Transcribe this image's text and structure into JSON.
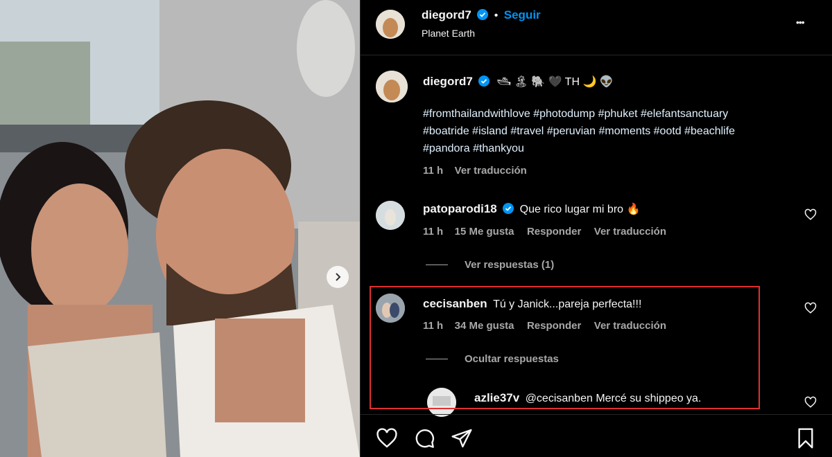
{
  "post": {
    "author": "diegord7",
    "follow_label": "Seguir",
    "location": "Planet Earth",
    "more_label": "•••",
    "caption_emojis": "🛥 🏝 🐘 🖤 TH 🌙 👽",
    "caption": [
      "#fromthailandwithlove #photodump #phuket #elefantsanctuary",
      "#boatride #island #travel #peruvian #moments #ootd #beachlife",
      "#pandora #thankyou"
    ],
    "caption_time": "11 h",
    "caption_translate": "Ver traducción"
  },
  "comments": [
    {
      "user": "patoparodi18",
      "verified": true,
      "text": "Que rico lugar mi bro 🔥",
      "time": "11 h",
      "likes": "15 Me gusta",
      "reply": "Responder",
      "translate": "Ver traducción",
      "replies_toggle": "Ver respuestas (1)"
    },
    {
      "user": "cecisanben",
      "verified": false,
      "text": "Tú y Janick...pareja perfecta!!!",
      "time": "11 h",
      "likes": "34 Me gusta",
      "reply": "Responder",
      "translate": "Ver traducción",
      "replies_toggle": "Ocultar respuestas"
    }
  ],
  "reply": {
    "user": "azlie37v",
    "text": "@cecisanben Mercé su shippeo ya."
  },
  "icons": {
    "like": "heart-icon",
    "comment": "comment-icon",
    "share": "share-icon",
    "save": "bookmark-icon",
    "next": "chevron-right-icon",
    "verified": "verified-badge-icon"
  },
  "colors": {
    "background": "#000000",
    "link": "#0095f6",
    "verified": "#0095f6",
    "highlight": "#e0312f"
  }
}
